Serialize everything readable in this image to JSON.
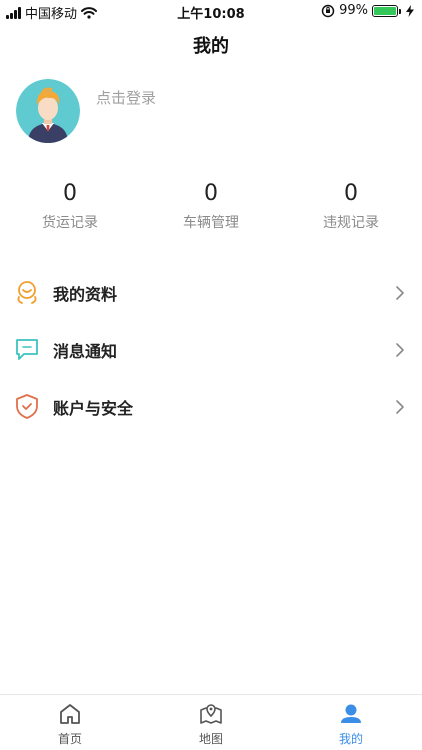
{
  "status_bar": {
    "carrier": "中国移动",
    "time": "上午10:08",
    "battery_percent": "99%",
    "battery_level": 0.99,
    "signal_icon": "signal-icon",
    "wifi_icon": "wifi-icon",
    "lock_icon": "orientation-lock-icon",
    "charging_icon": "charging-bolt-icon"
  },
  "nav": {
    "title": "我的"
  },
  "profile": {
    "login_text": "点击登录"
  },
  "stats": [
    {
      "value": "0",
      "label": "货运记录"
    },
    {
      "value": "0",
      "label": "车辆管理"
    },
    {
      "value": "0",
      "label": "违规记录"
    }
  ],
  "menu": [
    {
      "label": "我的资料",
      "icon": "profile-info-icon",
      "color": "#f0a030"
    },
    {
      "label": "消息通知",
      "icon": "message-icon",
      "color": "#3cc3c0"
    },
    {
      "label": "账户与安全",
      "icon": "shield-icon",
      "color": "#e0704a"
    }
  ],
  "tabs": [
    {
      "label": "首页",
      "icon": "home-icon",
      "active": false
    },
    {
      "label": "地图",
      "icon": "map-icon",
      "active": false
    },
    {
      "label": "我的",
      "icon": "user-icon",
      "active": true
    }
  ],
  "colors": {
    "accent": "#3a8ee6",
    "muted_text": "#8a8a8a"
  }
}
